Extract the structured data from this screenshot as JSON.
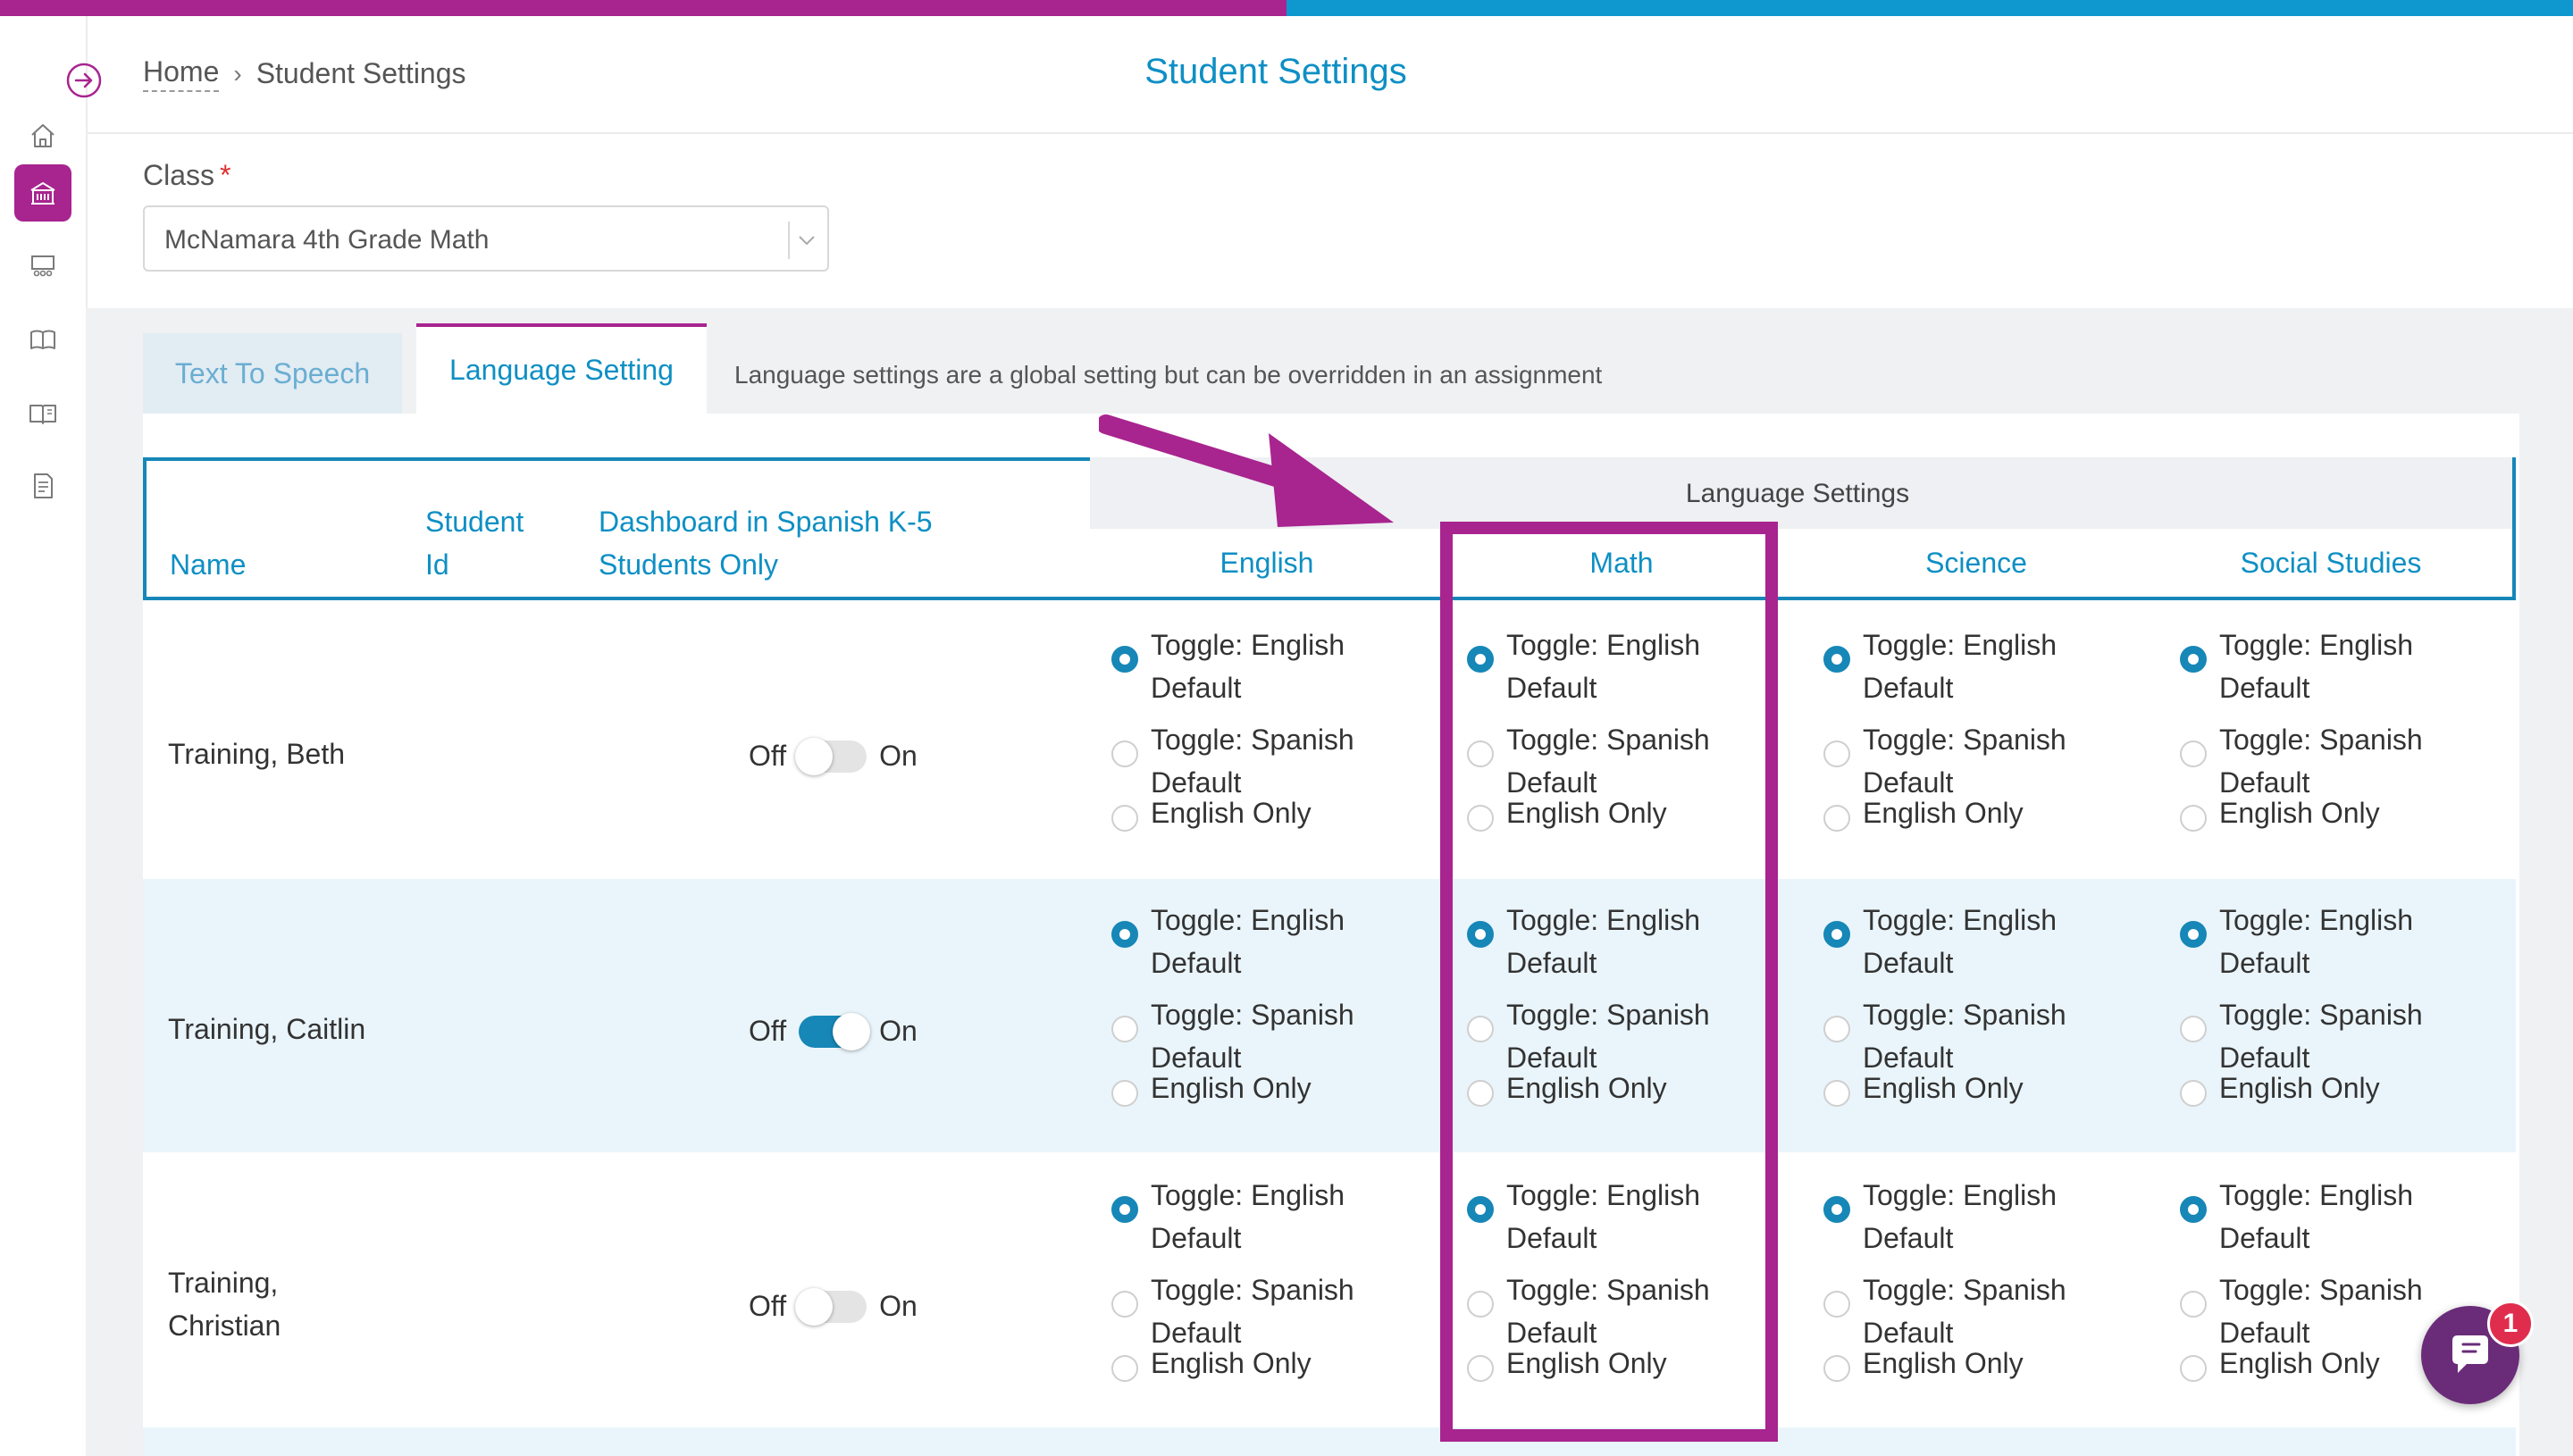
{
  "colors": {
    "brand_purple": "#a8248f",
    "accent_blue": "#0e8fc4",
    "row_alt": "#eaf5fb"
  },
  "sidebar": {
    "icons": [
      "arrow-circle-right-icon",
      "home-icon",
      "school-icon",
      "classroom-icon",
      "book-icon",
      "reading-icon",
      "document-icon"
    ],
    "active": "school-icon"
  },
  "breadcrumb": {
    "home": "Home",
    "separator": "›",
    "current": "Student Settings"
  },
  "page": {
    "title": "Student Settings"
  },
  "class_field": {
    "label": "Class",
    "required_mark": "*",
    "value": "McNamara 4th Grade Math"
  },
  "tabs": {
    "tts": "Text To Speech",
    "language": "Language Setting",
    "active": "language",
    "note": "Language settings are a global setting but can be overridden in an assignment"
  },
  "table": {
    "headers": {
      "name": "Name",
      "student_id_line1": "Student",
      "student_id_line2": "Id",
      "dashboard_line1": "Dashboard in Spanish K-5",
      "dashboard_line2": "Students Only",
      "group": "Language Settings",
      "english": "English",
      "math": "Math",
      "science": "Science",
      "social_studies": "Social Studies"
    },
    "options": {
      "opt1_line1": "Toggle: English",
      "opt1_line2": "Default",
      "opt2_line1": "Toggle: Spanish",
      "opt2_line2": "Default",
      "opt3": "English Only"
    },
    "toggle": {
      "off": "Off",
      "on": "On"
    },
    "rows": [
      {
        "name_line1": "Training, Beth",
        "name_line2": "",
        "dashboard_spanish": false,
        "selected": {
          "english": 1,
          "math": 1,
          "science": 1,
          "social_studies": 1
        }
      },
      {
        "name_line1": "Training, Caitlin",
        "name_line2": "",
        "dashboard_spanish": true,
        "selected": {
          "english": 1,
          "math": 1,
          "science": 1,
          "social_studies": 1
        }
      },
      {
        "name_line1": "Training,",
        "name_line2": "Christian",
        "dashboard_spanish": false,
        "selected": {
          "english": 1,
          "math": 1,
          "science": 1,
          "social_studies": 1
        }
      }
    ]
  },
  "annotation": {
    "highlighted_column": "math",
    "arrow_color": "#a8248f"
  },
  "chat": {
    "badge": "1"
  }
}
